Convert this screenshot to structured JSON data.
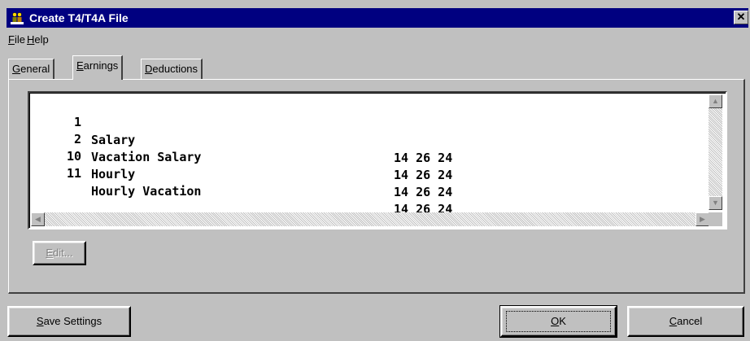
{
  "window": {
    "title": "Create T4/T4A File",
    "close_glyph": "✕",
    "app_icon": "people-icon"
  },
  "menu": {
    "file_key": "F",
    "file_rest": "ile",
    "help_key": "H",
    "help_rest": "elp"
  },
  "tabs": [
    {
      "key": "G",
      "rest": "eneral"
    },
    {
      "key": "E",
      "rest": "arnings"
    },
    {
      "key": "D",
      "rest": "eductions"
    }
  ],
  "active_tab": "Earnings",
  "earnings_list": [
    {
      "num": "1",
      "name": "Salary",
      "codes": "14 26 24"
    },
    {
      "num": "2",
      "name": "Vacation Salary",
      "codes": "14 26 24"
    },
    {
      "num": "10",
      "name": "Hourly",
      "codes": "14 26 24"
    },
    {
      "num": "11",
      "name": "Hourly Vacation",
      "codes": "14 26 24"
    }
  ],
  "scroll": {
    "up": "▲",
    "down": "▼",
    "left": "◀",
    "right": "▶"
  },
  "buttons": {
    "edit_key": "E",
    "edit_rest": "dit...",
    "save_key": "S",
    "save_rest": "ave Settings",
    "ok_key": "O",
    "ok_rest": "K",
    "cancel_key": "C",
    "cancel_rest": "ancel"
  },
  "colors": {
    "titlebar": "#000080",
    "face": "#c0c0c0"
  }
}
